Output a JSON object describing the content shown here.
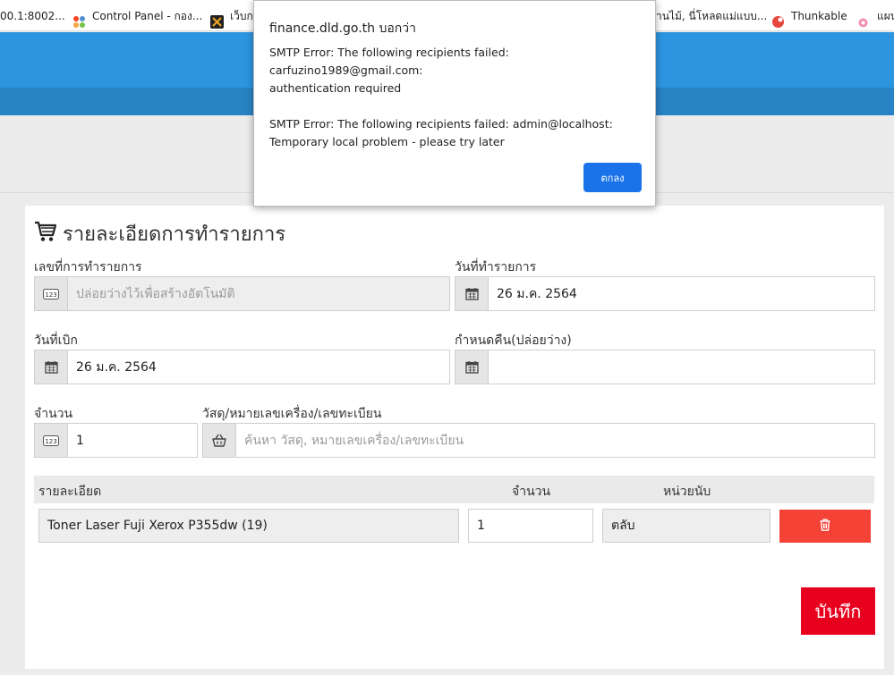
{
  "browser": {
    "bookmarks": [
      {
        "label": "00.1:8002...",
        "icon": "none"
      },
      {
        "label": "Control Panel - กอง...",
        "icon": "joomla-icon"
      },
      {
        "label": "เว็บกอ",
        "icon": "site-icon"
      },
      {
        "label": "านไม้, นี่โหลดแม่แบบ...",
        "icon": "none"
      },
      {
        "label": "Thunkable",
        "icon": "thunkable-icon"
      },
      {
        "label": "แผน",
        "icon": "pin-icon"
      }
    ]
  },
  "dialog": {
    "title": "finance.dld.go.th บอกว่า",
    "message": "SMTP Error: The following recipients failed: carfuzino1989@gmail.com:\nauthentication required\n\nSMTP Error: The following recipients failed: admin@localhost:\nTemporary local problem - please try later",
    "ok_label": "ตกลง"
  },
  "form": {
    "title": "รายละเอียดการทำรายการ",
    "transaction_no": {
      "label": "เลขที่การทำรายการ",
      "placeholder": "ปล่อยว่างไว้เพื่อสร้างอัตโนมัติ"
    },
    "transaction_date": {
      "label": "วันที่ทำรายการ",
      "value": "26 ม.ค. 2564"
    },
    "withdraw_date": {
      "label": "วันที่เบิก",
      "value": "26 ม.ค. 2564"
    },
    "return_date": {
      "label": "กำหนดคืน(ปล่อยว่าง)",
      "value": ""
    },
    "quantity": {
      "label": "จำนวน",
      "value": "1"
    },
    "item_search": {
      "label": "วัสดุ/หมายเลขเครื่อง/เลขทะเบียน",
      "placeholder": "ค้นหา วัสดุ, หมายเลขเครื่อง/เลขทะเบียน"
    }
  },
  "table": {
    "headers": {
      "detail": "รายละเอียด",
      "quantity": "จำนวน",
      "unit": "หน่วยนับ"
    },
    "rows": [
      {
        "detail": "Toner Laser Fuji Xerox P355dw (19)",
        "quantity": "1",
        "unit": "ตลับ"
      }
    ]
  },
  "save_label": "บันทึก",
  "colors": {
    "header": "#2d95e0",
    "header_dark": "#2883c4",
    "delete": "#f44336",
    "save": "#e8001f",
    "dialog_ok": "#1a73e8"
  }
}
